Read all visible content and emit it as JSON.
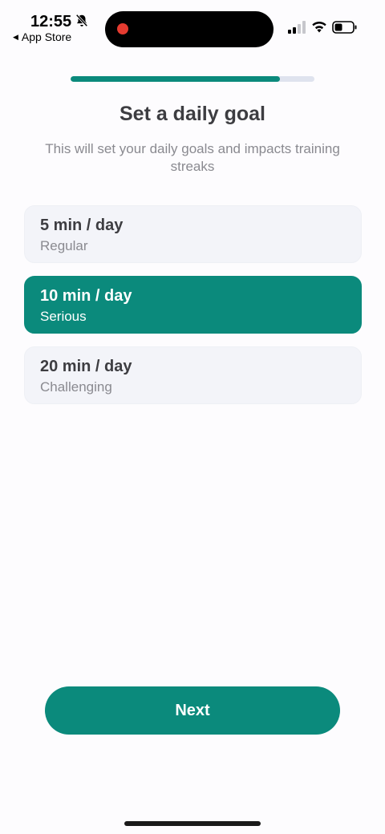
{
  "status_bar": {
    "time": "12:55",
    "back_label": "App Store",
    "icons": [
      "bell-slash-icon",
      "signal-icon",
      "wifi-icon",
      "battery-icon"
    ]
  },
  "progress": {
    "fraction": 0.86,
    "color": "#0b8a7c"
  },
  "header": {
    "title": "Set a daily goal",
    "subtitle": "This will set your daily goals and impacts training streaks"
  },
  "options": [
    {
      "title": "5 min / day",
      "subtitle": "Regular",
      "selected": false
    },
    {
      "title": "10 min / day",
      "subtitle": "Serious",
      "selected": true
    },
    {
      "title": "20 min / day",
      "subtitle": "Challenging",
      "selected": false
    }
  ],
  "footer": {
    "next_label": "Next"
  },
  "colors": {
    "accent": "#0b8a7c",
    "background": "#fdfcfe",
    "option_bg": "#f3f4f9"
  }
}
